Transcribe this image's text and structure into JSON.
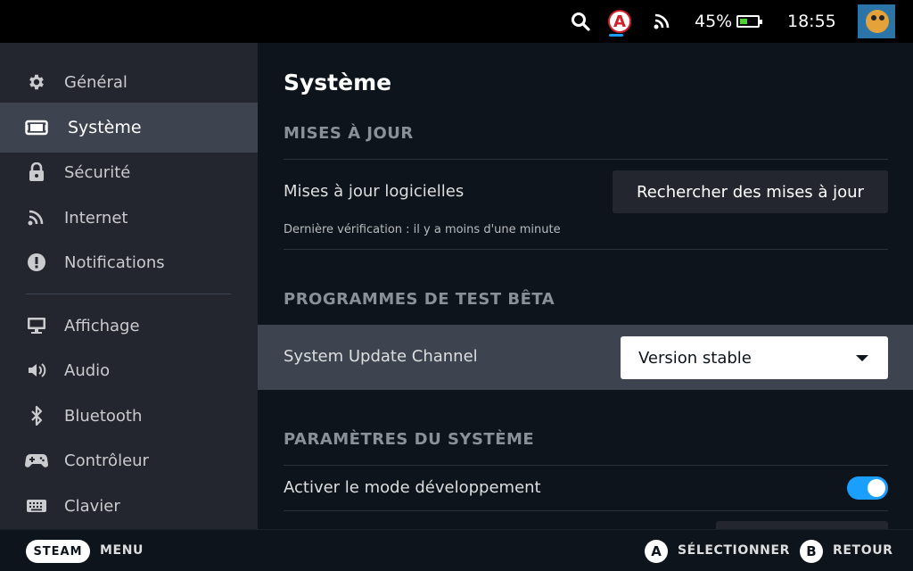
{
  "topbar": {
    "battery_percent": "45%",
    "battery_level": 0.45,
    "time": "18:55",
    "a_badge": "A",
    "icons": [
      "search-icon",
      "notification-a-icon",
      "wifi-icon",
      "battery-icon",
      "avatar"
    ]
  },
  "sidebar": {
    "items": [
      {
        "label": "Général",
        "icon": "gear-icon"
      },
      {
        "label": "Système",
        "icon": "system-icon"
      },
      {
        "label": "Sécurité",
        "icon": "lock-icon"
      },
      {
        "label": "Internet",
        "icon": "wifi-icon"
      },
      {
        "label": "Notifications",
        "icon": "alert-icon"
      },
      {
        "label": "Affichage",
        "icon": "monitor-icon"
      },
      {
        "label": "Audio",
        "icon": "speaker-icon"
      },
      {
        "label": "Bluetooth",
        "icon": "bluetooth-icon"
      },
      {
        "label": "Contrôleur",
        "icon": "gamepad-icon"
      },
      {
        "label": "Clavier",
        "icon": "keyboard-icon"
      }
    ],
    "active": "Système"
  },
  "main": {
    "title": "Système",
    "updates": {
      "heading": "MISES À JOUR",
      "label": "Mises à jour logicielles",
      "button": "Rechercher des mises à jour",
      "last_check": "Dernière vérification : il y a moins d'une minute"
    },
    "beta": {
      "heading": "PROGRAMMES DE TEST BÊTA",
      "label": "System Update Channel",
      "selected": "Version stable"
    },
    "system_settings": {
      "heading": "PARAMÈTRES DU SYSTÈME",
      "dev_mode_label": "Activer le mode développement",
      "dev_mode_on": true
    }
  },
  "bottombar": {
    "steam": "STEAM",
    "menu": "MENU",
    "a_glyph": "A",
    "select": "SÉLECTIONNER",
    "b_glyph": "B",
    "back": "RETOUR"
  },
  "colors": {
    "accent": "#1a9fff",
    "sidebar_bg": "#23262e",
    "active_bg": "#3d4450",
    "main_bg": "#0e141b",
    "battery_green": "#4cd137"
  }
}
